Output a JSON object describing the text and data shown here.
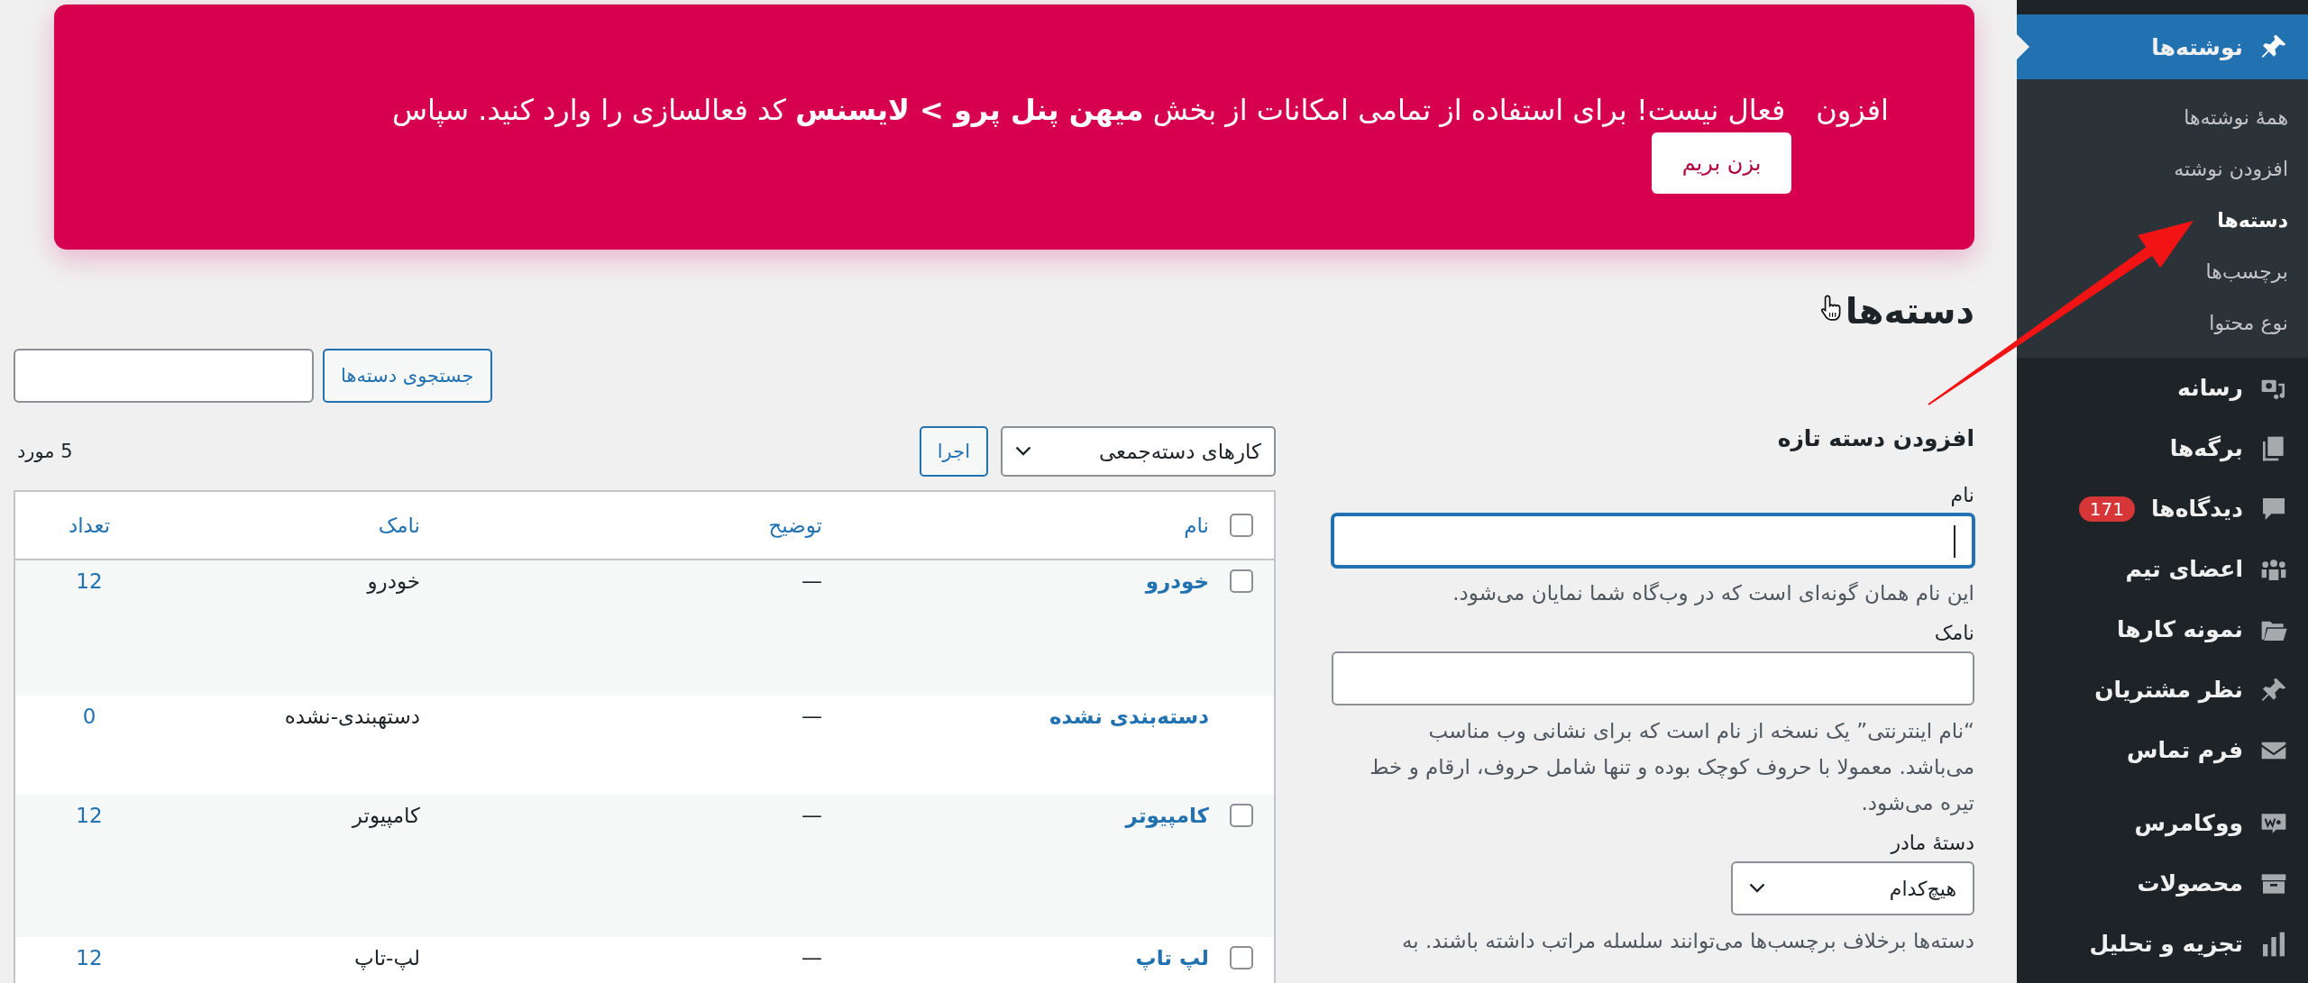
{
  "banner": {
    "text_start": "افزون",
    "text_rest": "فعال نیست! برای استفاده از تمامی امکانات از بخش **میهن پنل پرو > لایسنس** کد فعالسازی را وارد کنید. سپاس",
    "button": "بزن بریم"
  },
  "page_title": "دسته‌ها",
  "form": {
    "title": "افزودن دسته تازه",
    "fields": [
      {
        "kind": "text",
        "label": "نام",
        "focused": true,
        "help": "این نام همان گونه‌ای است که در وب‌گاه شما نمایان می‌شود."
      },
      {
        "kind": "text",
        "label": "نامک",
        "focused": false,
        "help": "“نام اینترنتی” یک نسخه از نام است که برای نشانی وب مناسب می‌باشد. معمولا با حروف کوچک بوده و تنها شامل حروف، ارقام و خط تیره می‌شود."
      },
      {
        "kind": "select",
        "label": "دستهٔ مادر",
        "value": "هیچ‌کدام",
        "help": "دسته‌ها برخلاف برچسب‌ها می‌توانند سلسله مراتب داشته باشند. به"
      }
    ]
  },
  "list": {
    "search_button": "جستجوی دسته‌ها",
    "bulk_select": "کارهای دسته‌جمعی",
    "apply_button": "اجرا",
    "count": "5 مورد"
  },
  "table": {
    "select_all_checked": false,
    "columns": [
      "نام",
      "توضیح",
      "نامک",
      "تعداد"
    ],
    "rows": [
      {
        "kind": "normal",
        "checked": false,
        "name": "خودرو",
        "description": "—",
        "slug": "خودرو",
        "count": "12"
      },
      {
        "kind": "default",
        "name": "دسته‌بندی نشده",
        "description": "—",
        "slug": "دستهبندی-نشده",
        "count": "0"
      },
      {
        "kind": "normal",
        "checked": false,
        "name": "کامپیوتر",
        "description": "—",
        "slug": "کامپیوتر",
        "count": "12"
      },
      {
        "kind": "normal",
        "checked": false,
        "name": "لپ تاپ",
        "description": "—",
        "slug": "لپ-تاپ",
        "count": "12"
      }
    ]
  },
  "sidebar": {
    "items": [
      {
        "label": "نوشته‌ها",
        "selected": true,
        "submenu": [
          {
            "label": "همهٔ نوشته‌ها",
            "selected": false
          },
          {
            "label": "افزودن نوشته",
            "selected": false
          },
          {
            "label": "دسته‌ها",
            "selected": true
          },
          {
            "label": "برچسب‌ها",
            "selected": false
          },
          {
            "label": "نوع محتوا",
            "selected": false
          }
        ]
      },
      {
        "label": "رسانه",
        "selected": false
      },
      {
        "label": "برگه‌ها",
        "selected": false
      },
      {
        "label": "دیدگاه‌ها",
        "selected": false,
        "badge": "171"
      },
      {
        "label": "اعضای تیم",
        "selected": false
      },
      {
        "label": "نمونه کارها",
        "selected": false
      },
      {
        "label": "نظر مشتریان",
        "selected": false
      },
      {
        "label": "فرم تماس",
        "selected": false
      },
      {
        "label": "ووکامرس",
        "selected": false
      },
      {
        "label": "محصولات",
        "selected": false
      },
      {
        "label": "تجزیه و تحلیل",
        "selected": false
      }
    ]
  }
}
